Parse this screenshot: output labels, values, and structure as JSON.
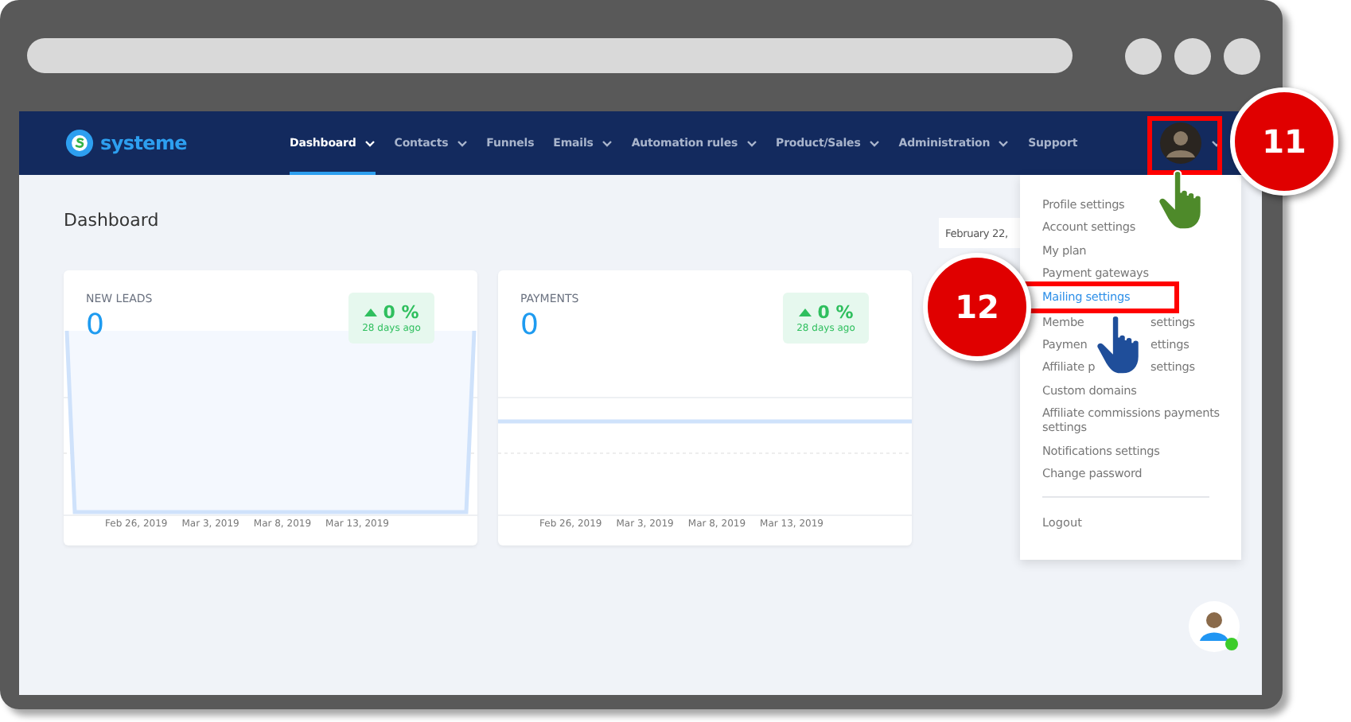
{
  "brand": {
    "name": "systeme"
  },
  "nav": [
    {
      "label": "Dashboard",
      "selected": true,
      "has_menu": true
    },
    {
      "label": "Contacts",
      "selected": false,
      "has_menu": true
    },
    {
      "label": "Funnels",
      "selected": false,
      "has_menu": false
    },
    {
      "label": "Emails",
      "selected": false,
      "has_menu": true
    },
    {
      "label": "Automation rules",
      "selected": false,
      "has_menu": true
    },
    {
      "label": "Product/Sales",
      "selected": false,
      "has_menu": true
    },
    {
      "label": "Administration",
      "selected": false,
      "has_menu": true
    },
    {
      "label": "Support",
      "selected": false,
      "has_menu": false
    }
  ],
  "page_title": "Dashboard",
  "date_range": "February 22,",
  "cards": [
    {
      "title": "NEW LEADS",
      "value": "0",
      "change": "0 %",
      "change_note": "28 days ago",
      "kind": "spikes",
      "dates": [
        "Feb 26, 2019",
        "Mar 3, 2019",
        "Mar 8, 2019",
        "Mar 13, 2019"
      ]
    },
    {
      "title": "PAYMENTS",
      "value": "0",
      "change": "0 %",
      "change_note": "28 days ago",
      "kind": "flat",
      "dates": [
        "Feb 26, 2019",
        "Mar 3, 2019",
        "Mar 8, 2019",
        "Mar 13, 2019"
      ]
    }
  ],
  "user_menu": {
    "items": [
      {
        "label": "Profile settings",
        "selected": false
      },
      {
        "label": "Account settings",
        "selected": false
      },
      {
        "label": "My plan",
        "selected": false
      },
      {
        "label": "Payment gateways",
        "selected": false
      },
      {
        "label": "Mailing settings",
        "selected": true
      },
      {
        "label_start": "Membe",
        "label_end": "settings",
        "selected": false
      },
      {
        "label_start": "Paymen",
        "label_end": "ettings",
        "selected": false
      },
      {
        "label_start": "Affiliate p",
        "label_end": "settings",
        "selected": false
      },
      {
        "label": "Custom domains",
        "selected": false
      },
      {
        "label": "Affiliate commissions payments settings",
        "selected": false
      },
      {
        "label": "Notifications settings",
        "selected": false
      },
      {
        "label": "Change password",
        "selected": false
      }
    ],
    "logout": "Logout"
  },
  "callouts": [
    {
      "number": "11",
      "kind": "avatar"
    },
    {
      "number": "12",
      "kind": "menu"
    }
  ]
}
